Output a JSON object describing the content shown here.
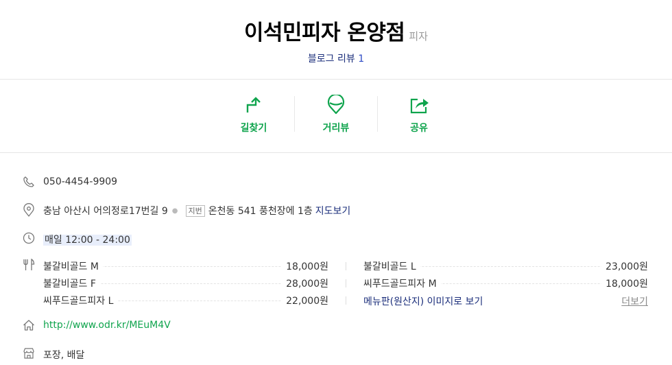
{
  "header": {
    "title": "이석민피자 온양점",
    "category": "피자",
    "review_label": "블로그 리뷰",
    "review_count": "1"
  },
  "actions": [
    {
      "label": "길찾기",
      "icon": "directions-icon"
    },
    {
      "label": "거리뷰",
      "icon": "street-view-icon"
    },
    {
      "label": "공유",
      "icon": "share-icon"
    }
  ],
  "info": {
    "phone": "050-4454-9909",
    "address": "충남 아산시 어의정로17번길 9",
    "jibun_badge": "지번",
    "jibun_address": "온천동 541 풍천장에 1층",
    "map_link": "지도보기",
    "hours": "매일 12:00 - 24:00",
    "menu": [
      {
        "name": "불갈비골드 M",
        "price": "18,000원"
      },
      {
        "name": "불갈비골드 L",
        "price": "23,000원"
      },
      {
        "name": "불갈비골드 F",
        "price": "28,000원"
      },
      {
        "name": "씨푸드골드피자 M",
        "price": "18,000원"
      },
      {
        "name": "씨푸드골드피자 L",
        "price": "22,000원"
      }
    ],
    "menu_image_link": "메뉴판(원산지) 이미지로 보기",
    "more_link": "더보기",
    "website": "http://www.odr.kr/MEuM4V",
    "services": "포장, 배달"
  },
  "colors": {
    "accent": "#0fa44d",
    "link": "#1a2d7a"
  }
}
